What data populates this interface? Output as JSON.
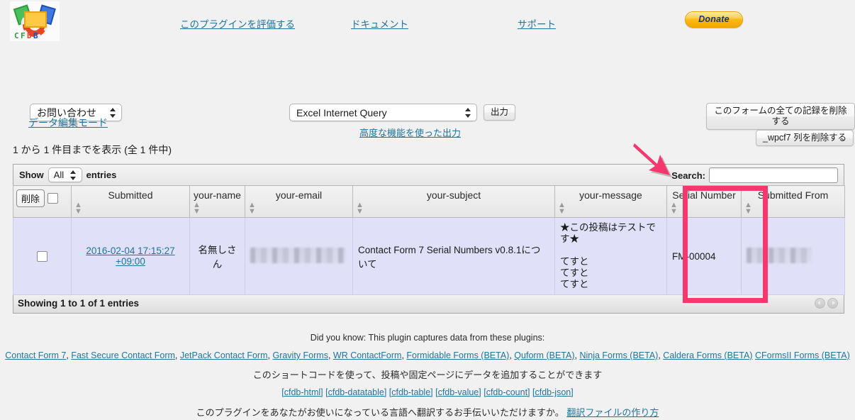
{
  "header": {
    "logo_alt": "CFDB logo",
    "links": [
      {
        "label": "このプラグインを評価する"
      },
      {
        "label": "ドキュメント"
      },
      {
        "label": "サポート"
      }
    ],
    "donate_label": "Donate"
  },
  "controls": {
    "form_select_value": "お問い合わせ",
    "export_select_value": "Excel Internet Query",
    "export_button_label": "出力",
    "advanced_export_link": "高度な機能を使った出力",
    "delete_all_button": "このフォームの全ての記録を削除する",
    "delete_column_button": "_wpcf7 列を削除する"
  },
  "edit_mode_link": "データ編集モード",
  "range_info": "1 から 1 件目までを表示 (全 1 件中)",
  "datatable": {
    "length_label_before": "Show",
    "length_value": "All",
    "length_label_after": "entries",
    "search_label": "Search:",
    "search_value": "",
    "search_placeholder": "",
    "delete_header_button": "削除",
    "columns": [
      {
        "label": "削除",
        "sortable": false
      },
      {
        "label": "Submitted",
        "sortable": true
      },
      {
        "label": "your-name",
        "sortable": true
      },
      {
        "label": "your-email",
        "sortable": true
      },
      {
        "label": "your-subject",
        "sortable": true
      },
      {
        "label": "your-message",
        "sortable": true
      },
      {
        "label": "Serial Number",
        "sortable": true
      },
      {
        "label": "Submitted From",
        "sortable": true
      }
    ],
    "rows": [
      {
        "submitted": "2016-02-04 17:15:27 +09:00",
        "your_name": "名無しさん",
        "your_email": "",
        "your_subject": "Contact Form 7 Serial Numbers v0.8.1について",
        "your_message": "★この投稿はテストです★\n\nてすと\nてすと\nてすと",
        "serial_number": "FM-00004",
        "submitted_from": ""
      }
    ],
    "info": "Showing 1 to 1 of 1 entries"
  },
  "footer": {
    "did_you_know": "Did you know: This plugin captures data from these plugins:",
    "plugins": [
      "Contact Form 7",
      "Fast Secure Contact Form",
      "JetPack Contact Form",
      "Gravity Forms",
      "WR ContactForm",
      "Formidable Forms (BETA)",
      "Quform (BETA)",
      "Ninja Forms (BETA)",
      "Caldera Forms (BETA)",
      "CFormsII Forms (BETA)"
    ],
    "shortcode_text": "このショートコードを使って、投稿や固定ページにデータを追加することができます",
    "shortcodes": [
      "[cfdb-html]",
      "[cfdb-datatable]",
      "[cfdb-table]",
      "[cfdb-value]",
      "[cfdb-count]",
      "[cfdb-json]"
    ],
    "translate_text": "このプラグインをあなたがお使いになっている言語へ翻訳するお手伝いいただけますか。",
    "translate_link": "翻訳ファイルの作り方"
  },
  "annotations": {
    "highlight_color": "#f8376e",
    "arrow_target": "Serial Number column"
  }
}
